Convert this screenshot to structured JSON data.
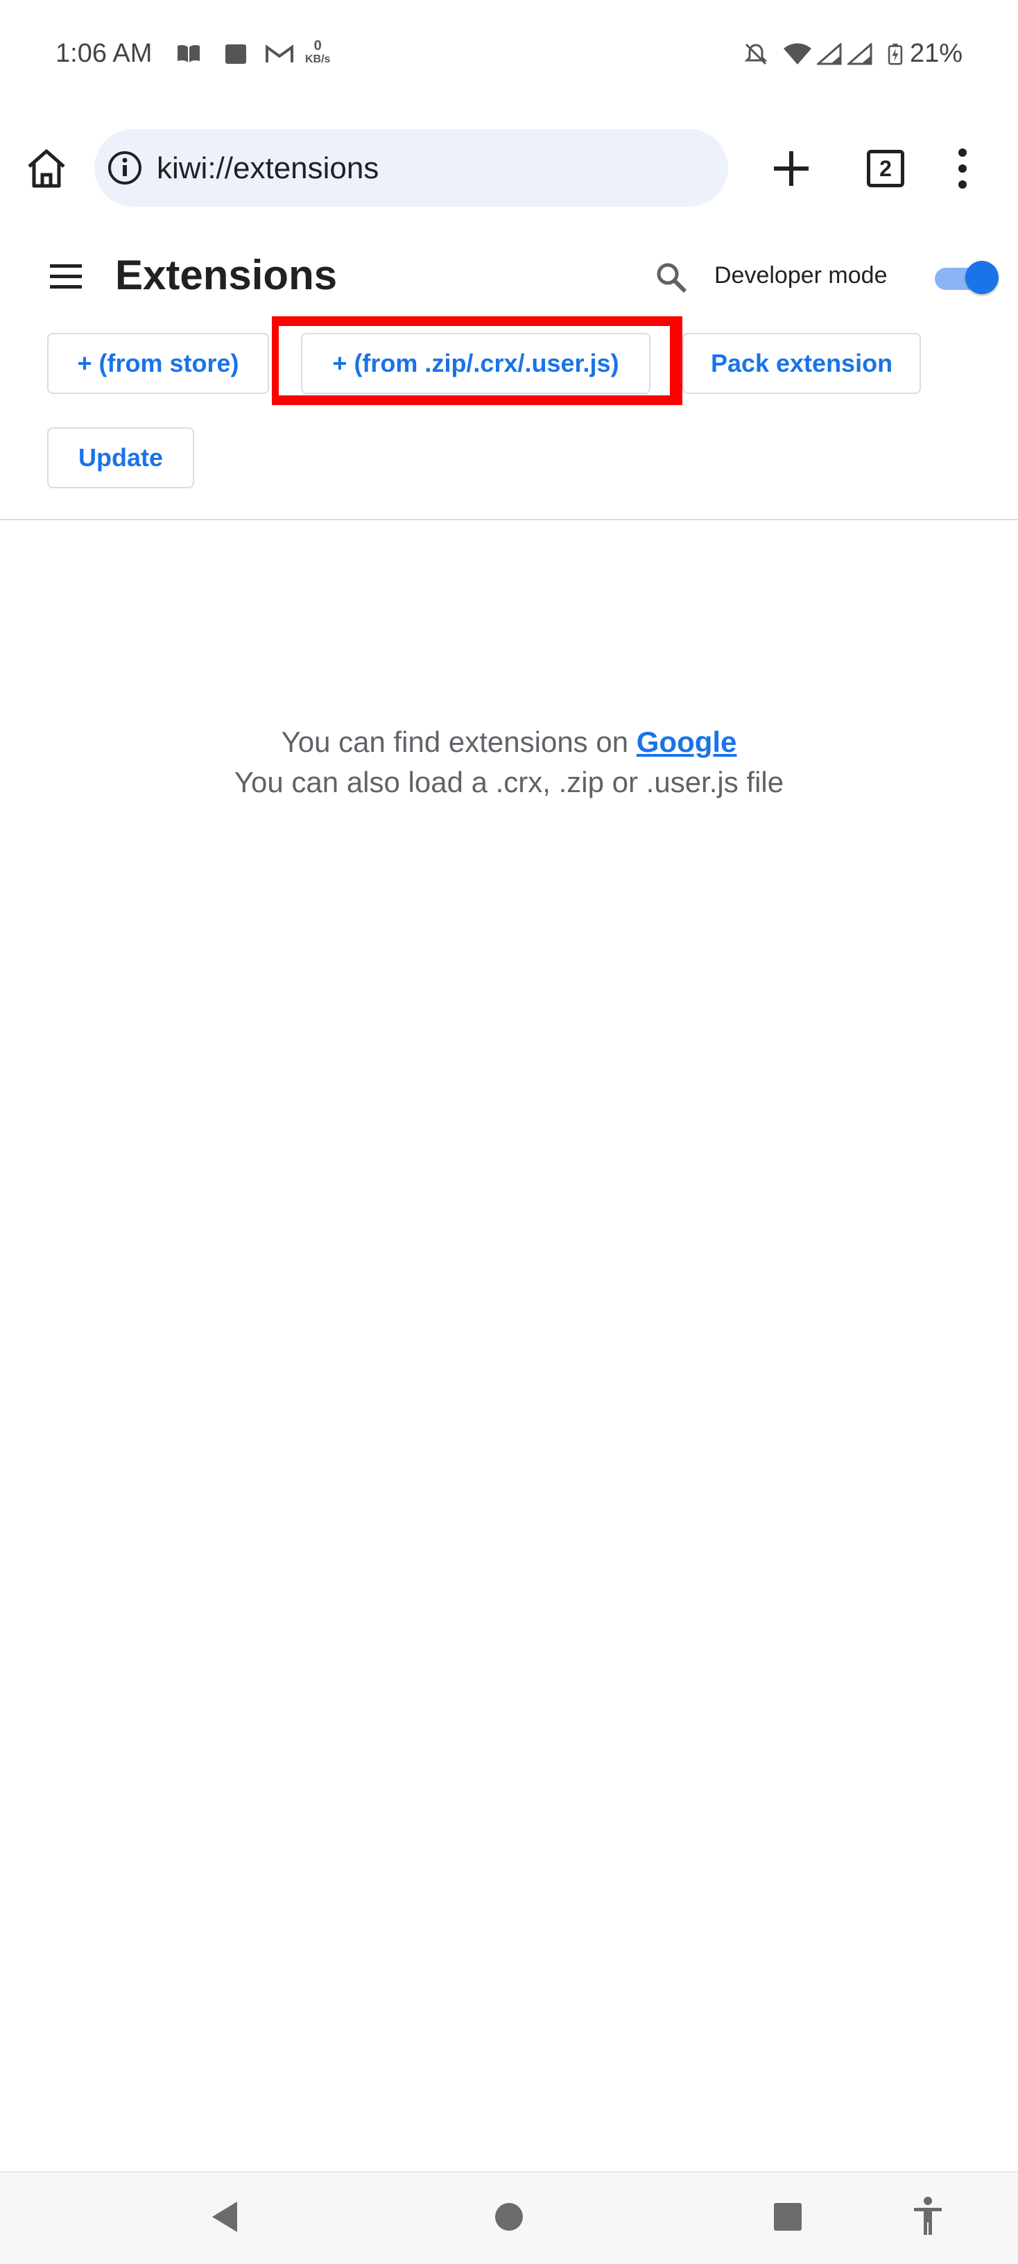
{
  "status_bar": {
    "time": "1:06 AM",
    "net_speed_value": "0",
    "net_speed_unit": "KB/s",
    "battery": "21%",
    "icons": [
      "book-icon",
      "square-icon",
      "gmail-icon",
      "bell-off-icon",
      "wifi-icon",
      "signal-icon",
      "signal-icon",
      "battery-charging-icon"
    ]
  },
  "toolbar": {
    "url": "kiwi://extensions",
    "tab_count": "2",
    "icons": [
      "home-icon",
      "info-icon",
      "plus-icon",
      "tabs-icon",
      "more-vert-icon"
    ]
  },
  "header": {
    "title": "Extensions",
    "developer_mode_label": "Developer mode",
    "developer_mode_on": true,
    "icons": [
      "menu-icon",
      "search-icon"
    ]
  },
  "actions": {
    "from_store": "+ (from store)",
    "from_file": "+ (from .zip/.crx/.user.js)",
    "pack": "Pack extension",
    "update": "Update"
  },
  "empty_state": {
    "line1_prefix": "You can find extensions on ",
    "line1_link": "Google",
    "line2": "You can also load a .crx, .zip or .user.js file"
  },
  "colors": {
    "accent": "#1a73e8",
    "highlight": "#ff0000",
    "urlbar_bg": "#edf2fa"
  },
  "navbar": {
    "icons": [
      "back-icon",
      "home-circle-icon",
      "recents-icon",
      "accessibility-icon"
    ]
  }
}
